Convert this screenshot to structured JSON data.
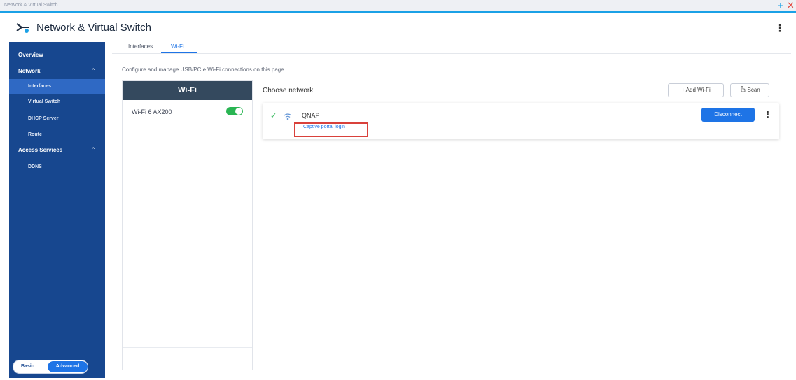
{
  "window": {
    "title": "Network & Virtual Switch",
    "controls": {
      "minimize": "—",
      "maximize": "+",
      "close": "✕"
    },
    "accent_color": "#1aa1e6"
  },
  "app": {
    "title": "Network & Virtual Switch",
    "icon": "network-switch-icon",
    "more_icon": "⋮"
  },
  "sidebar": {
    "bg_color": "#17478f",
    "items": [
      {
        "label": "Overview"
      },
      {
        "label": "Network",
        "caret": "⌃"
      },
      {
        "label": "Interfaces"
      },
      {
        "label": "Virtual Switch"
      },
      {
        "label": "DHCP Server"
      },
      {
        "label": "Route"
      },
      {
        "label": "Access Services",
        "caret": "⌃"
      },
      {
        "label": "DDNS"
      }
    ],
    "mode": {
      "basic": "Basic",
      "advanced": "Advanced"
    }
  },
  "tabs": [
    {
      "label": "Interfaces"
    },
    {
      "label": "Wi-Fi"
    }
  ],
  "description": "Configure and manage USB/PCIe Wi-Fi connections on this page.",
  "wifi_panel": {
    "header": "Wi-Fi",
    "adapter": "Wi-Fi 6 AX200",
    "toggle_on": true,
    "toggle_color": "#2ab553"
  },
  "networks": {
    "heading": "Choose network",
    "add_button": "Add Wi-Fi",
    "add_icon": "+",
    "scan_button": "Scan",
    "scan_icon": "hand-icon",
    "connected": {
      "check": "✓",
      "ssid": "QNAP",
      "portal_link": "Captive portal login",
      "disconnect_button": "Disconnect",
      "more_icon": "⋮"
    }
  }
}
